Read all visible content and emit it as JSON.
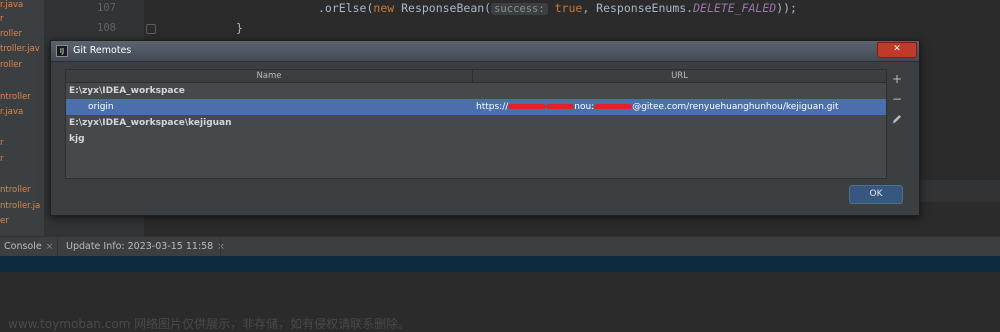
{
  "project_tree": {
    "items": [
      "r.java",
      "r",
      "roller",
      "troller.java",
      "roller",
      "ntroller",
      "r.java",
      "r",
      "r",
      "ntroller",
      "ntroller.java",
      "er"
    ]
  },
  "editor": {
    "lines": [
      {
        "number": "107",
        "pre": ".orElse(",
        "kw": "new",
        "cls": " ResponseBean(",
        "hint": "success:",
        "val": " true",
        "mid": ", ResponseEnums.",
        "italic": "DELETE_FALED",
        "post": "));"
      },
      {
        "number": "108",
        "pre": "}"
      }
    ]
  },
  "bottom_tabs": [
    {
      "label": "Console",
      "close": "×"
    },
    {
      "label": "Update Info: 2023-03-15 11:58",
      "close": "×"
    }
  ],
  "watermark": "www.toymoban.com 网络图片仅供展示，非存储，如有侵权请联系删除。",
  "dialog": {
    "title": "Git Remotes",
    "app_icon_text": "IJ",
    "close_label": "✕",
    "columns": {
      "name": "Name",
      "url": "URL"
    },
    "rows": [
      {
        "name": "E:\\zyx\\IDEA_workspace",
        "url": "",
        "type": "group"
      },
      {
        "name": "origin",
        "url_prefix": "https://",
        "url_mid": "nou:",
        "url_suffix": "@gitee.com/renyuehuanghunhou/kejiguan.git",
        "type": "remote",
        "selected": true
      },
      {
        "name": "E:\\zyx\\IDEA_workspace\\kejiguan",
        "url": "",
        "type": "group"
      },
      {
        "name": "kjg",
        "url": "",
        "type": "group"
      }
    ],
    "tools": {
      "add": "+",
      "remove": "−",
      "edit_icon": "pencil-icon"
    },
    "ok_label": "OK"
  },
  "colors": {
    "selection": "#4b6eaf",
    "redaction": "#e0222a",
    "editor_bg": "#2b2b2b",
    "dialog_bg": "#3c3f41"
  }
}
